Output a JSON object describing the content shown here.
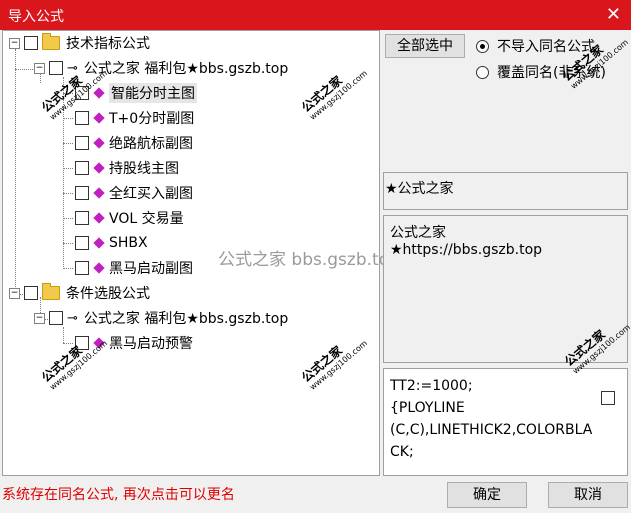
{
  "window": {
    "title": "导入公式",
    "close_glyph": "✕"
  },
  "tree": {
    "groups": [
      {
        "label": "技术指标公式",
        "expander": "−",
        "sub": {
          "label": "公式之家 福利包★bbs.gszb.top",
          "expander": "−",
          "icon": "⊸"
        },
        "items": [
          "智能分时主图",
          "T+0分时副图",
          "绝路航标副图",
          "持股线主图",
          "全红买入副图",
          "VOL 交易量",
          "SHBX",
          "黑马启动副图"
        ]
      },
      {
        "label": "条件选股公式",
        "expander": "−",
        "sub": {
          "label": "公式之家 福利包★bbs.gszb.top",
          "expander": "−",
          "icon": "⊸"
        },
        "items": [
          "黑马启动预警"
        ]
      }
    ]
  },
  "watermarks": {
    "brand": "公式之家",
    "url": "www.gszj100.com",
    "center": "公式之家 bbs.gszb.top"
  },
  "right": {
    "select_all": "全部选中",
    "radio_skip": "不导入同名公式",
    "radio_overwrite": "覆盖同名(非系统)",
    "radio_selected": "skip",
    "name_box": "★公式之家",
    "desc_line1": "公式之家",
    "desc_line2": "★https://bbs.gszb.top",
    "code_lines": [
      "TT2:=1000;",
      "{PLOYLINE",
      "(C,C),LINETHICK2,COLORBLA",
      "CK;"
    ]
  },
  "footer": {
    "status": "系统存在同名公式, 再次点击可以更名",
    "ok": "确定",
    "cancel": "取消"
  },
  "colors": {
    "titlebar": "#d9161c",
    "status_text": "#e00000",
    "diamond": "#c020c0",
    "folder": "#f3c94a"
  }
}
